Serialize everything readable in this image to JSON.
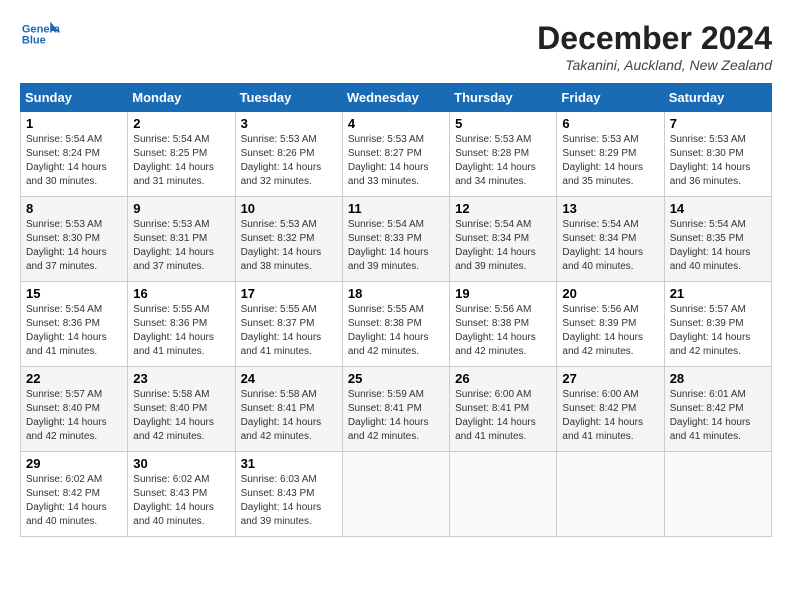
{
  "logo": {
    "line1": "General",
    "line2": "Blue"
  },
  "title": "December 2024",
  "location": "Takanini, Auckland, New Zealand",
  "weekdays": [
    "Sunday",
    "Monday",
    "Tuesday",
    "Wednesday",
    "Thursday",
    "Friday",
    "Saturday"
  ],
  "weeks": [
    [
      {
        "day": "1",
        "sunrise": "5:54 AM",
        "sunset": "8:24 PM",
        "daylight": "14 hours and 30 minutes."
      },
      {
        "day": "2",
        "sunrise": "5:54 AM",
        "sunset": "8:25 PM",
        "daylight": "14 hours and 31 minutes."
      },
      {
        "day": "3",
        "sunrise": "5:53 AM",
        "sunset": "8:26 PM",
        "daylight": "14 hours and 32 minutes."
      },
      {
        "day": "4",
        "sunrise": "5:53 AM",
        "sunset": "8:27 PM",
        "daylight": "14 hours and 33 minutes."
      },
      {
        "day": "5",
        "sunrise": "5:53 AM",
        "sunset": "8:28 PM",
        "daylight": "14 hours and 34 minutes."
      },
      {
        "day": "6",
        "sunrise": "5:53 AM",
        "sunset": "8:29 PM",
        "daylight": "14 hours and 35 minutes."
      },
      {
        "day": "7",
        "sunrise": "5:53 AM",
        "sunset": "8:30 PM",
        "daylight": "14 hours and 36 minutes."
      }
    ],
    [
      {
        "day": "8",
        "sunrise": "5:53 AM",
        "sunset": "8:30 PM",
        "daylight": "14 hours and 37 minutes."
      },
      {
        "day": "9",
        "sunrise": "5:53 AM",
        "sunset": "8:31 PM",
        "daylight": "14 hours and 37 minutes."
      },
      {
        "day": "10",
        "sunrise": "5:53 AM",
        "sunset": "8:32 PM",
        "daylight": "14 hours and 38 minutes."
      },
      {
        "day": "11",
        "sunrise": "5:54 AM",
        "sunset": "8:33 PM",
        "daylight": "14 hours and 39 minutes."
      },
      {
        "day": "12",
        "sunrise": "5:54 AM",
        "sunset": "8:34 PM",
        "daylight": "14 hours and 39 minutes."
      },
      {
        "day": "13",
        "sunrise": "5:54 AM",
        "sunset": "8:34 PM",
        "daylight": "14 hours and 40 minutes."
      },
      {
        "day": "14",
        "sunrise": "5:54 AM",
        "sunset": "8:35 PM",
        "daylight": "14 hours and 40 minutes."
      }
    ],
    [
      {
        "day": "15",
        "sunrise": "5:54 AM",
        "sunset": "8:36 PM",
        "daylight": "14 hours and 41 minutes."
      },
      {
        "day": "16",
        "sunrise": "5:55 AM",
        "sunset": "8:36 PM",
        "daylight": "14 hours and 41 minutes."
      },
      {
        "day": "17",
        "sunrise": "5:55 AM",
        "sunset": "8:37 PM",
        "daylight": "14 hours and 41 minutes."
      },
      {
        "day": "18",
        "sunrise": "5:55 AM",
        "sunset": "8:38 PM",
        "daylight": "14 hours and 42 minutes."
      },
      {
        "day": "19",
        "sunrise": "5:56 AM",
        "sunset": "8:38 PM",
        "daylight": "14 hours and 42 minutes."
      },
      {
        "day": "20",
        "sunrise": "5:56 AM",
        "sunset": "8:39 PM",
        "daylight": "14 hours and 42 minutes."
      },
      {
        "day": "21",
        "sunrise": "5:57 AM",
        "sunset": "8:39 PM",
        "daylight": "14 hours and 42 minutes."
      }
    ],
    [
      {
        "day": "22",
        "sunrise": "5:57 AM",
        "sunset": "8:40 PM",
        "daylight": "14 hours and 42 minutes."
      },
      {
        "day": "23",
        "sunrise": "5:58 AM",
        "sunset": "8:40 PM",
        "daylight": "14 hours and 42 minutes."
      },
      {
        "day": "24",
        "sunrise": "5:58 AM",
        "sunset": "8:41 PM",
        "daylight": "14 hours and 42 minutes."
      },
      {
        "day": "25",
        "sunrise": "5:59 AM",
        "sunset": "8:41 PM",
        "daylight": "14 hours and 42 minutes."
      },
      {
        "day": "26",
        "sunrise": "6:00 AM",
        "sunset": "8:41 PM",
        "daylight": "14 hours and 41 minutes."
      },
      {
        "day": "27",
        "sunrise": "6:00 AM",
        "sunset": "8:42 PM",
        "daylight": "14 hours and 41 minutes."
      },
      {
        "day": "28",
        "sunrise": "6:01 AM",
        "sunset": "8:42 PM",
        "daylight": "14 hours and 41 minutes."
      }
    ],
    [
      {
        "day": "29",
        "sunrise": "6:02 AM",
        "sunset": "8:42 PM",
        "daylight": "14 hours and 40 minutes."
      },
      {
        "day": "30",
        "sunrise": "6:02 AM",
        "sunset": "8:43 PM",
        "daylight": "14 hours and 40 minutes."
      },
      {
        "day": "31",
        "sunrise": "6:03 AM",
        "sunset": "8:43 PM",
        "daylight": "14 hours and 39 minutes."
      },
      null,
      null,
      null,
      null
    ]
  ]
}
